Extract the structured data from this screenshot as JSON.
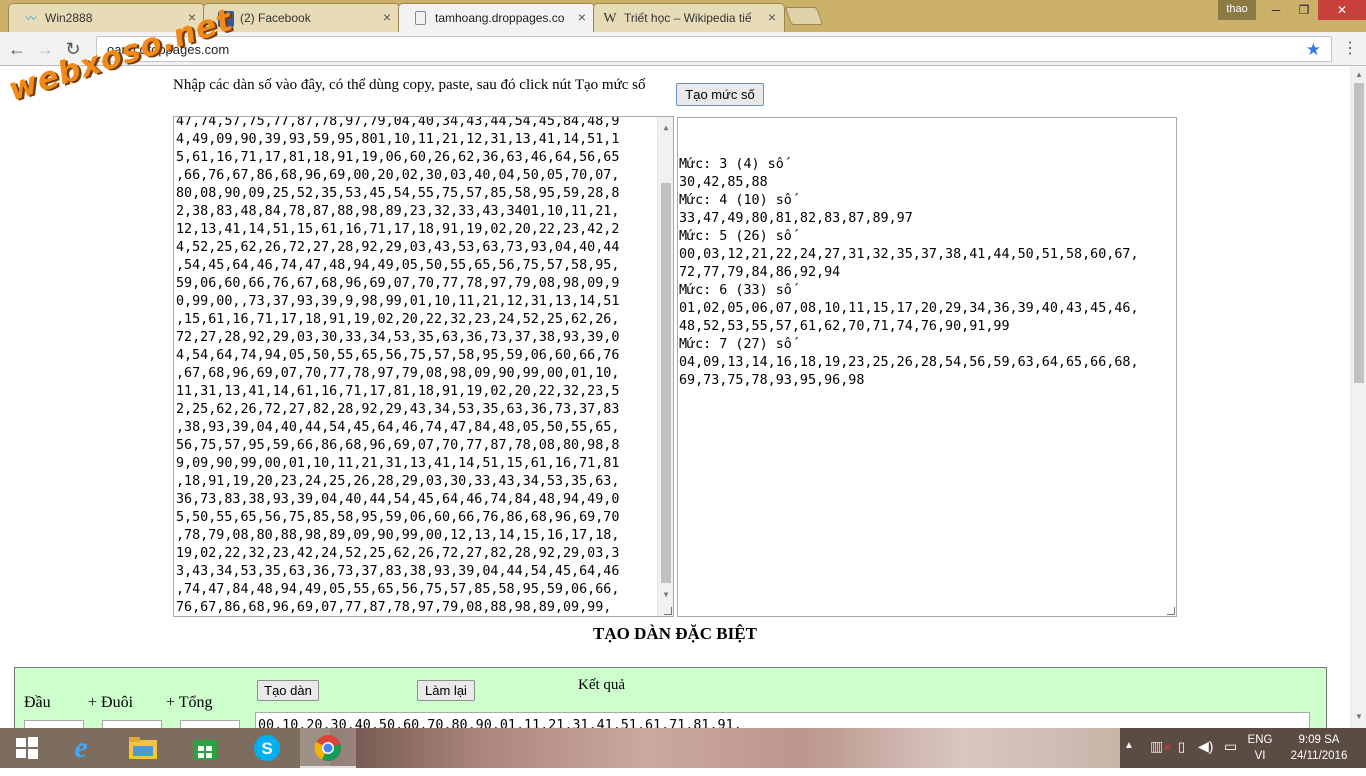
{
  "browser": {
    "tabs": [
      {
        "title": "Win2888",
        "icon": "win2888-favicon"
      },
      {
        "title": "(2) Facebook",
        "icon": "facebook-icon"
      },
      {
        "title": "tamhoang.droppages.co",
        "icon": "page-icon"
      },
      {
        "title": "Triết học – Wikipedia tiế",
        "icon": "wikipedia-icon"
      }
    ],
    "user": "thao",
    "url": "oang.droppages.com",
    "window_controls": {
      "minimize": "─",
      "maximize": "❐",
      "close": "✕"
    }
  },
  "watermark": "webxoso.net",
  "page": {
    "instruction": "Nhập các dàn số vào đây, có thể dùng copy, paste, sau đó click nút Tạo mức số",
    "create_level_button": "Tạo mức số",
    "input_lines": [
      "47,74,57,75,77,87,78,97,79,04,40,34,43,44,54,45,84,48,9",
      "4,49,09,90,39,93,59,95,801,10,11,21,12,31,13,41,14,51,1",
      "5,61,16,71,17,81,18,91,19,06,60,26,62,36,63,46,64,56,65",
      ",66,76,67,86,68,96,69,00,20,02,30,03,40,04,50,05,70,07,",
      "80,08,90,09,25,52,35,53,45,54,55,75,57,85,58,95,59,28,8",
      "2,38,83,48,84,78,87,88,98,89,23,32,33,43,3401,10,11,21,",
      "12,13,41,14,51,15,61,16,71,17,18,91,19,02,20,22,23,42,2",
      "4,52,25,62,26,72,27,28,92,29,03,43,53,63,73,93,04,40,44",
      ",54,45,64,46,74,47,48,94,49,05,50,55,65,56,75,57,58,95,",
      "59,06,60,66,76,67,68,96,69,07,70,77,78,97,79,08,98,09,9",
      "0,99,00,,73,37,93,39,9,98,99,01,10,11,21,12,31,13,14,51",
      ",15,61,16,71,17,18,91,19,02,20,22,32,23,24,52,25,62,26,",
      "72,27,28,92,29,03,30,33,34,53,35,63,36,73,37,38,93,39,0",
      "4,54,64,74,94,05,50,55,65,56,75,57,58,95,59,06,60,66,76",
      ",67,68,96,69,07,70,77,78,97,79,08,98,09,90,99,00,01,10,",
      "11,31,13,41,14,61,16,71,17,81,18,91,19,02,20,22,32,23,5",
      "2,25,62,26,72,27,82,28,92,29,43,34,53,35,63,36,73,37,83",
      ",38,93,39,04,40,44,54,45,64,46,74,47,84,48,05,50,55,65,",
      "56,75,57,95,59,66,86,68,96,69,07,70,77,87,78,08,80,98,8",
      "9,09,90,99,00,01,10,11,21,31,13,41,14,51,15,61,16,71,81",
      ",18,91,19,20,23,24,25,26,28,29,03,30,33,43,34,53,35,63,",
      "36,73,83,38,93,39,04,40,44,54,45,64,46,74,84,48,94,49,0",
      "5,50,55,65,56,75,85,58,95,59,06,60,66,76,86,68,96,69,70",
      ",78,79,08,80,88,98,89,09,90,99,00,12,13,14,15,16,17,18,",
      "19,02,22,32,23,42,24,52,25,62,26,72,27,82,28,92,29,03,3",
      "3,43,34,53,35,63,36,73,37,83,38,93,39,04,44,54,45,64,46",
      ",74,47,84,48,94,49,05,55,65,56,75,57,85,58,95,59,06,66,",
      "76,67,86,68,96,69,07,77,87,78,97,79,08,88,98,89,09,99,"
    ],
    "output_lines": [
      "Mức: 3 (4) số",
      "30,42,85,88",
      "Mức: 4 (10) số",
      "33,47,49,80,81,82,83,87,89,97",
      "Mức: 5 (26) số",
      "00,03,12,21,22,24,27,31,32,35,37,38,41,44,50,51,58,60,67,",
      "72,77,79,84,86,92,94",
      "Mức: 6 (33) số",
      "01,02,05,06,07,08,10,11,15,17,20,29,34,36,39,40,43,45,46,",
      "48,52,53,55,57,61,62,70,71,74,76,90,91,99",
      "Mức: 7 (27) số",
      "04,09,13,14,16,18,19,23,25,26,28,54,56,59,63,64,65,66,68,",
      "69,73,75,78,93,95,96,98"
    ],
    "special_title": "TẠO DÀN ĐẶC BIỆT",
    "special": {
      "label_head": "Đầu",
      "label_tail": "+ Đuôi",
      "label_sum": "+ Tổng",
      "create_set_button": "Tạo dàn",
      "reset_button": "Làm lại",
      "result_label": "Kết quả",
      "result_value": "00,10,20,30,40,50,60,70,80,90,01,11,21,31,41,51,61,71,81,91,"
    }
  },
  "taskbar": {
    "apps": [
      "start-icon",
      "internet-explorer-icon",
      "file-explorer-icon",
      "store-icon",
      "skype-icon",
      "chrome-icon"
    ],
    "lang_top": "ENG",
    "lang_bottom": "VI",
    "time": "9:09 SA",
    "date": "24/11/2016"
  }
}
